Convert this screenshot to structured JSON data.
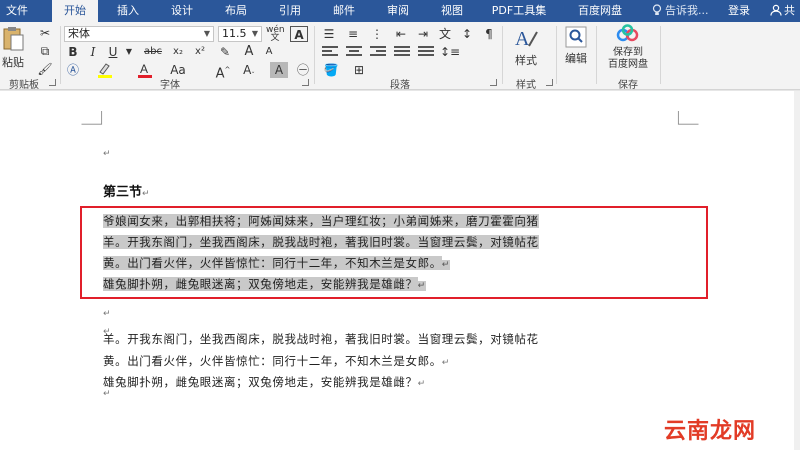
{
  "tabs": [
    "文件",
    "开始",
    "插入",
    "设计",
    "布局",
    "引用",
    "邮件",
    "审阅",
    "视图",
    "PDF工具集",
    "百度网盘"
  ],
  "tell_me": "告诉我...",
  "login": "登录",
  "share": "共",
  "ribbon": {
    "paste": "粘贴",
    "clipboard": "剪贴板",
    "font_name": "宋体",
    "font_size": "11.5",
    "font_group": "字体",
    "para_group": "段落",
    "styles": "样式",
    "styles_group": "样式",
    "edit": "编辑",
    "save_baidu_1": "保存到",
    "save_baidu_2": "百度网盘",
    "save_group": "保存",
    "bold": "B",
    "italic": "I",
    "underline": "U",
    "strike": "abc",
    "sub": "x₂",
    "sup": "x²",
    "grow": "A",
    "shrink": "A",
    "case": "Aa",
    "wen": "wén",
    "clear": "A"
  },
  "doc": {
    "mark": "↵",
    "heading": "第三节",
    "sel_line1": "爷娘闻女来，出郭相扶将；阿姊闻妹来，当户理红妆；小弟闻姊来，磨刀霍霍向猪",
    "sel_line2": "羊。开我东阁门，坐我西阁床，脱我战时袍，著我旧时裳。当窗理云鬓，对镜帖花",
    "sel_line3": "黄。出门看火伴，火伴皆惊忙：同行十二年，不知木兰是女郎。",
    "sel_line4": "雄兔脚扑朔，雌兔眼迷离；双兔傍地走，安能辨我是雄雌？",
    "line1": "羊。开我东阁门，坐我西阁床，脱我战时袍，著我旧时裳。当窗理云鬓，对镜帖花",
    "line2": "黄。出门看火伴，火伴皆惊忙：同行十二年，不知木兰是女郎。",
    "line3": "雄兔脚扑朔，雌兔眼迷离；双兔傍地走，安能辨我是雄雌？"
  },
  "watermark": "云南龙网",
  "colors": {
    "accent": "#2b579a",
    "selection_box": "#e11f2a",
    "font_red": "#e11f2a"
  }
}
